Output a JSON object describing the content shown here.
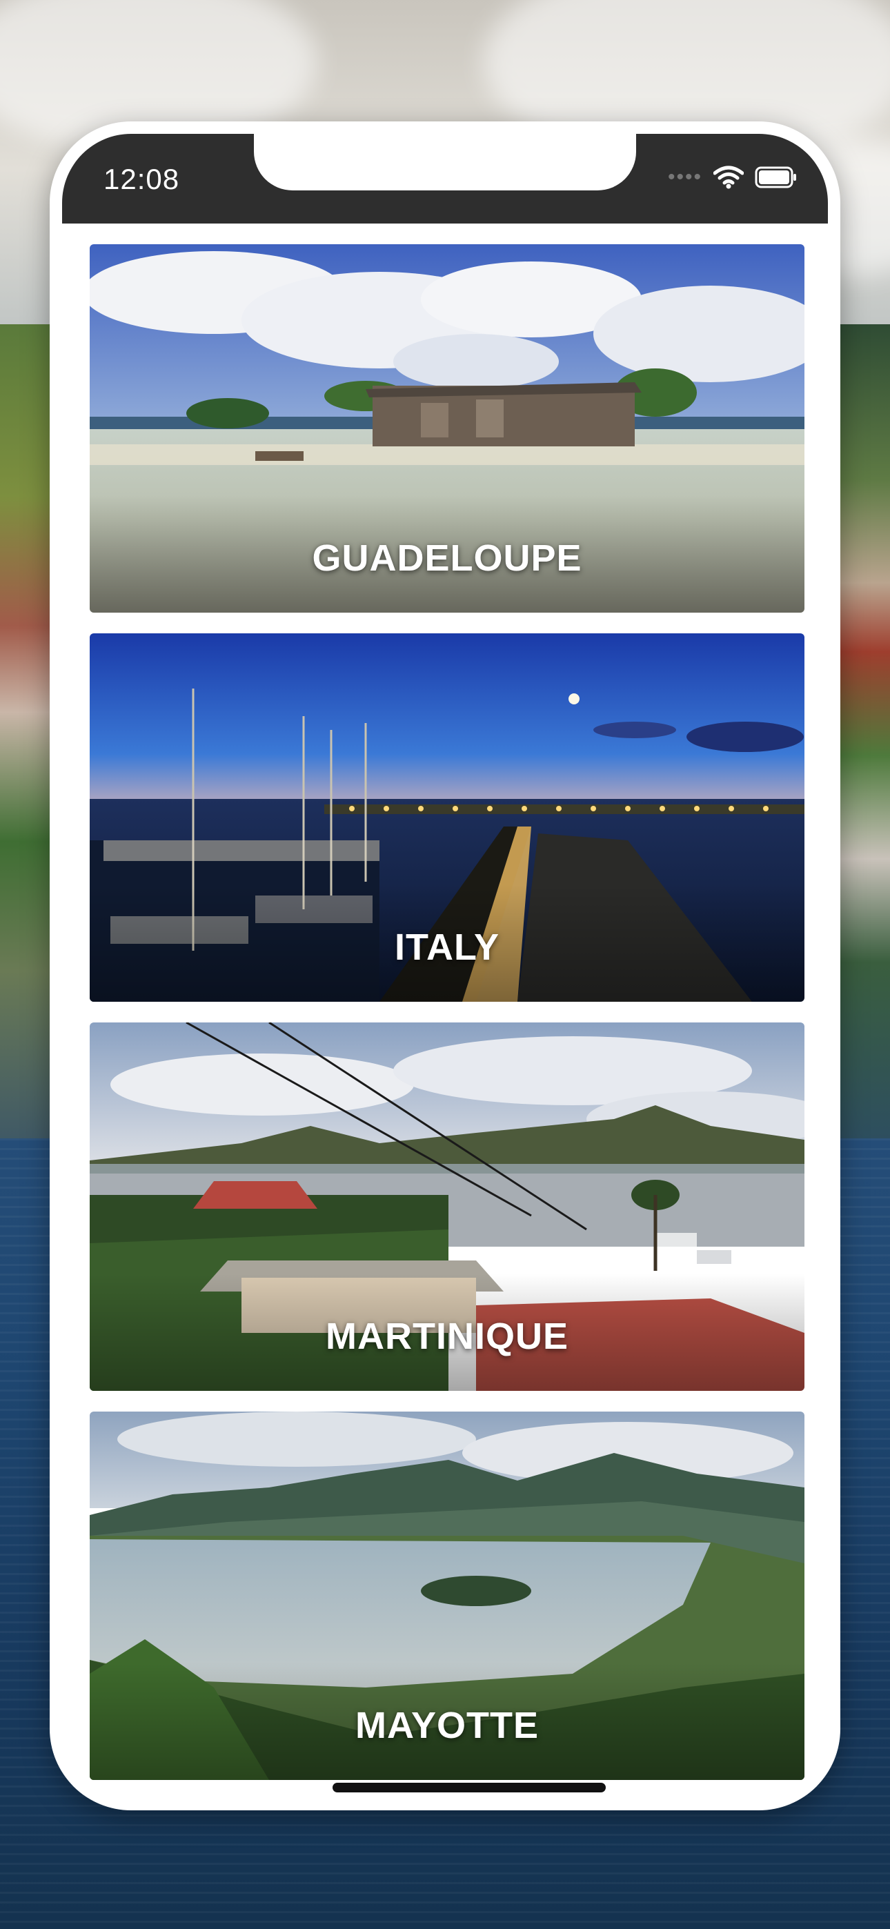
{
  "status_bar": {
    "time": "12:08",
    "icons": [
      "cellular-signal-icon",
      "wifi-icon",
      "battery-icon"
    ]
  },
  "destinations": [
    {
      "label": "GUADELOUPE",
      "image": "beach-hut-on-shallow-lagoon"
    },
    {
      "label": "ITALY",
      "image": "marina-at-dusk"
    },
    {
      "label": "MARTINIQUE",
      "image": "bay-with-sailboats-and-rooftops"
    },
    {
      "label": "MAYOTTE",
      "image": "lagoon-with-islet-and-mountains"
    }
  ],
  "colors": {
    "status_bar": "#2e2e2e",
    "phone_frame": "#ffffff",
    "label_text": "#ffffff"
  }
}
